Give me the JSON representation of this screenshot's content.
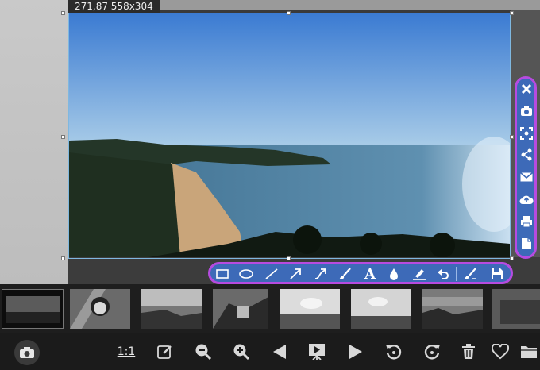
{
  "selection": {
    "readout": "271,87 558x304"
  },
  "zoom": {
    "one_to_one_label": "1:1"
  },
  "side_toolbar": {
    "items": [
      {
        "name": "close-icon"
      },
      {
        "name": "camera-icon"
      },
      {
        "name": "fullscreen-capture-icon"
      },
      {
        "name": "share-icon"
      },
      {
        "name": "email-icon"
      },
      {
        "name": "upload-cloud-icon"
      },
      {
        "name": "print-icon"
      },
      {
        "name": "copy-icon"
      }
    ]
  },
  "draw_toolbar": {
    "text_tool_label": "A",
    "items": [
      "rectangle-icon",
      "ellipse-icon",
      "line-icon",
      "arrow-icon",
      "curved-arrow-icon",
      "brush-icon",
      "text-icon",
      "blur-drop-icon",
      "highlighter-icon",
      "undo-icon",
      "clear-icon",
      "save-icon"
    ]
  },
  "colors": {
    "toolbar_bg": "#3d6ab8",
    "toolbar_border": "#b64be0",
    "selection_border": "#7fb8e0"
  }
}
